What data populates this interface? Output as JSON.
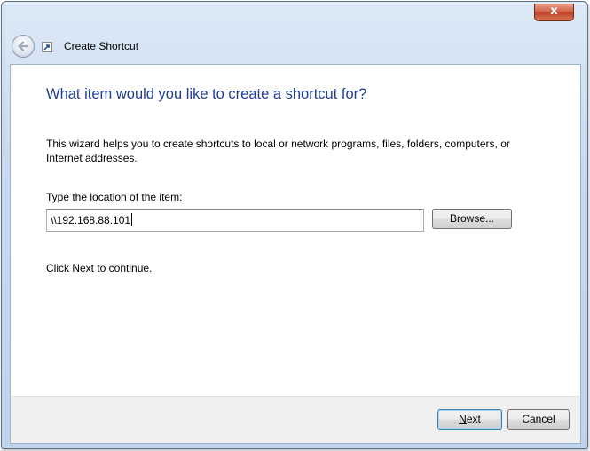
{
  "window": {
    "title": "Create Shortcut",
    "close_symbol": "x",
    "app_icon": "shortcut-icon",
    "back_icon": "back-arrow-icon"
  },
  "wizard": {
    "heading": "What item would you like to create a shortcut for?",
    "description": "This wizard helps you to create shortcuts to local or network programs, files, folders, computers, or Internet addresses.",
    "location_label": "Type the location of the item:",
    "location_value": "\\\\192.168.88.101",
    "browse_label": "Browse...",
    "continue_text": "Click Next to continue."
  },
  "footer": {
    "next_label_pre": "",
    "next_label_mnemonic": "N",
    "next_label_post": "ext",
    "cancel_label": "Cancel"
  },
  "colors": {
    "heading": "#1e3d94",
    "chrome": "#c7d9ef",
    "close": "#c24428"
  }
}
